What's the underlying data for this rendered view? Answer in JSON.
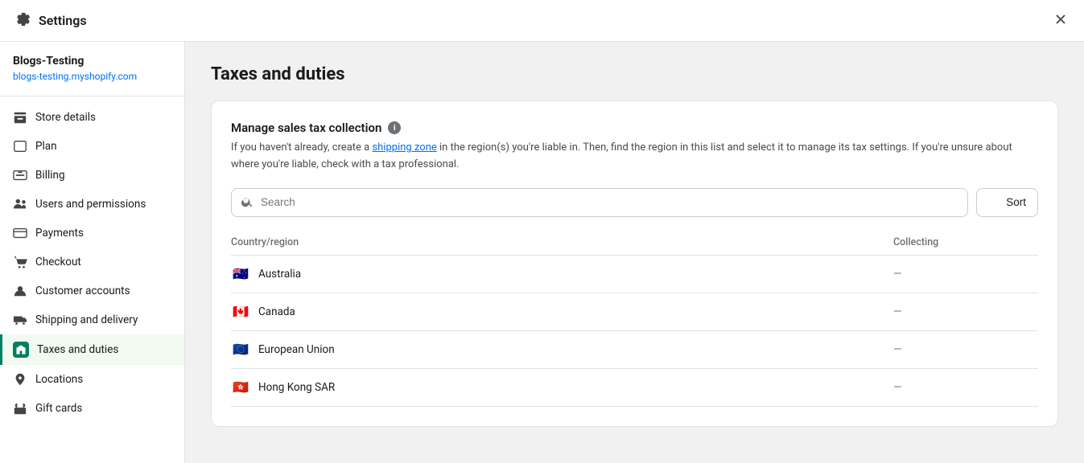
{
  "topbar": {
    "title": "Settings",
    "close_label": "×"
  },
  "sidebar": {
    "store_name": "Blogs-Testing",
    "store_url": "blogs-testing.myshopify.com",
    "items": [
      {
        "id": "store-details",
        "label": "Store details",
        "icon": "store-icon"
      },
      {
        "id": "plan",
        "label": "Plan",
        "icon": "plan-icon"
      },
      {
        "id": "billing",
        "label": "Billing",
        "icon": "billing-icon"
      },
      {
        "id": "users-permissions",
        "label": "Users and permissions",
        "icon": "users-icon"
      },
      {
        "id": "payments",
        "label": "Payments",
        "icon": "payments-icon"
      },
      {
        "id": "checkout",
        "label": "Checkout",
        "icon": "checkout-icon"
      },
      {
        "id": "customer-accounts",
        "label": "Customer accounts",
        "icon": "customer-icon"
      },
      {
        "id": "shipping-delivery",
        "label": "Shipping and delivery",
        "icon": "shipping-icon"
      },
      {
        "id": "taxes-duties",
        "label": "Taxes and duties",
        "icon": "taxes-icon",
        "active": true
      },
      {
        "id": "locations",
        "label": "Locations",
        "icon": "location-icon"
      },
      {
        "id": "gift-cards",
        "label": "Gift cards",
        "icon": "gift-icon"
      }
    ]
  },
  "main": {
    "page_title": "Taxes and duties",
    "card": {
      "section_title": "Manage sales tax collection",
      "description_part1": "If you haven't already, create a ",
      "link_text": "shipping zone",
      "description_part2": " in the region(s) you're liable in. Then, find the region in this list and select it to manage its tax settings. If you're unsure about where you're liable, check with a tax professional.",
      "search_placeholder": "Search",
      "sort_label": "Sort",
      "table": {
        "col1_header": "Country/region",
        "col2_header": "Collecting",
        "rows": [
          {
            "country": "Australia",
            "flag": "🇦🇺",
            "collecting": "—"
          },
          {
            "country": "Canada",
            "flag": "🇨🇦",
            "collecting": "—"
          },
          {
            "country": "European Union",
            "flag": "🇪🇺",
            "collecting": "—"
          },
          {
            "country": "Hong Kong SAR",
            "flag": "🇭🇰",
            "collecting": "—"
          }
        ]
      }
    }
  },
  "colors": {
    "active_green": "#008060",
    "link_blue": "#0070f3"
  }
}
